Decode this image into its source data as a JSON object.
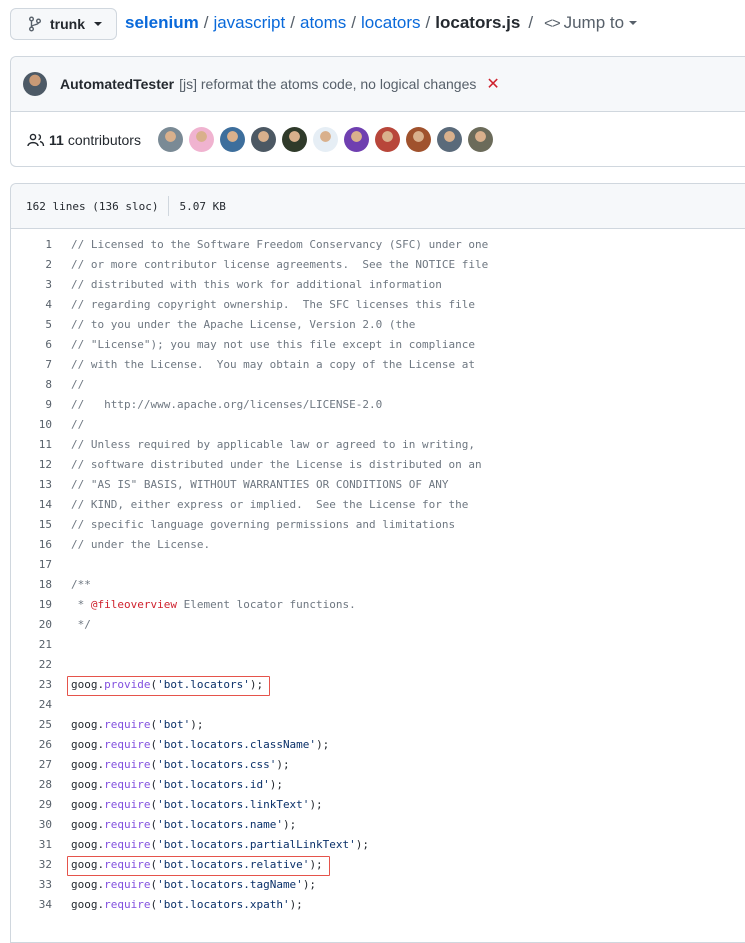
{
  "branch": {
    "name": "trunk"
  },
  "breadcrumb": {
    "repo": "selenium",
    "path": [
      "javascript",
      "atoms",
      "locators"
    ],
    "file": "locators.js",
    "sep": "/",
    "jump_label": "Jump to"
  },
  "commit": {
    "author": "AutomatedTester",
    "message": "[js] reformat the atoms code, no logical changes",
    "status": "✕",
    "status_color": "#cf222e"
  },
  "contributors": {
    "count": "11",
    "label": "contributors",
    "avatars": [
      "#7a8a95",
      "#f0b3d0",
      "#3d6e9c",
      "#4c5863",
      "#2f3a2a",
      "#e6eef5",
      "#6f3fb0",
      "#b8463a",
      "#a0522d",
      "#5a6a7a",
      "#6b6b5a"
    ]
  },
  "file_info": {
    "lines": "162 lines (136 sloc)",
    "size": "5.07 KB"
  },
  "code": [
    {
      "n": "1",
      "t": "// Licensed to the Software Freedom Conservancy (SFC) under one"
    },
    {
      "n": "2",
      "t": "// or more contributor license agreements.  See the NOTICE file"
    },
    {
      "n": "3",
      "t": "// distributed with this work for additional information"
    },
    {
      "n": "4",
      "t": "// regarding copyright ownership.  The SFC licenses this file"
    },
    {
      "n": "5",
      "t": "// to you under the Apache License, Version 2.0 (the"
    },
    {
      "n": "6",
      "t": "// \"License\"); you may not use this file except in compliance"
    },
    {
      "n": "7",
      "t": "// with the License.  You may obtain a copy of the License at"
    },
    {
      "n": "8",
      "t": "//"
    },
    {
      "n": "9",
      "t": "//   http://www.apache.org/licenses/LICENSE-2.0"
    },
    {
      "n": "10",
      "t": "//"
    },
    {
      "n": "11",
      "t": "// Unless required by applicable law or agreed to in writing,"
    },
    {
      "n": "12",
      "t": "// software distributed under the License is distributed on an"
    },
    {
      "n": "13",
      "t": "// \"AS IS\" BASIS, WITHOUT WARRANTIES OR CONDITIONS OF ANY"
    },
    {
      "n": "14",
      "t": "// KIND, either express or implied.  See the License for the"
    },
    {
      "n": "15",
      "t": "// specific language governing permissions and limitations"
    },
    {
      "n": "16",
      "t": "// under the License."
    },
    {
      "n": "17",
      "t": ""
    },
    {
      "n": "18",
      "t": "/**"
    },
    {
      "n": "19",
      "t": " * @fileoverview Element locator functions."
    },
    {
      "n": "20",
      "t": " */"
    },
    {
      "n": "21",
      "t": ""
    },
    {
      "n": "22",
      "t": ""
    },
    {
      "n": "23",
      "t": "goog.provide('bot.locators');",
      "highlighted": true
    },
    {
      "n": "24",
      "t": ""
    },
    {
      "n": "25",
      "t": "goog.require('bot');"
    },
    {
      "n": "26",
      "t": "goog.require('bot.locators.className');"
    },
    {
      "n": "27",
      "t": "goog.require('bot.locators.css');"
    },
    {
      "n": "28",
      "t": "goog.require('bot.locators.id');"
    },
    {
      "n": "29",
      "t": "goog.require('bot.locators.linkText');"
    },
    {
      "n": "30",
      "t": "goog.require('bot.locators.name');"
    },
    {
      "n": "31",
      "t": "goog.require('bot.locators.partialLinkText');"
    },
    {
      "n": "32",
      "t": "goog.require('bot.locators.relative');",
      "highlighted": true
    },
    {
      "n": "33",
      "t": "goog.require('bot.locators.tagName');"
    },
    {
      "n": "34",
      "t": "goog.require('bot.locators.xpath');"
    }
  ],
  "highlight_color": "#e5534b"
}
